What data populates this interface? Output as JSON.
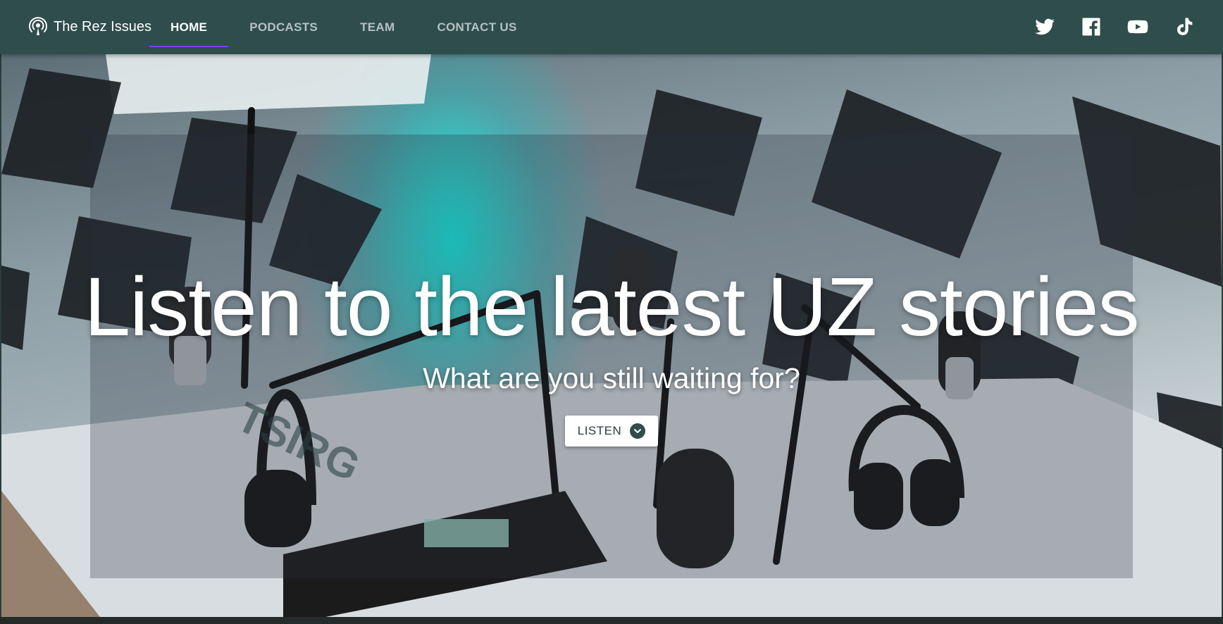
{
  "brand": {
    "title": "The Rez Issues",
    "icon": "podcast-icon"
  },
  "nav": {
    "items": [
      {
        "label": "HOME",
        "active": true
      },
      {
        "label": "PODCASTS",
        "active": false
      },
      {
        "label": "TEAM",
        "active": false
      },
      {
        "label": "CONTACT US",
        "active": false
      }
    ]
  },
  "socials": [
    "twitter-icon",
    "facebook-icon",
    "youtube-icon",
    "tiktok-icon"
  ],
  "hero": {
    "title": "Listen to the latest UZ stories",
    "subtitle": "What are you still waiting for?",
    "button_label": "LISTEN",
    "button_icon": "chevron-down-icon"
  },
  "colors": {
    "navbar": "#2f4d4b",
    "active_indicator": "#7e3ff2",
    "accent_cyan": "#00e5e0"
  }
}
